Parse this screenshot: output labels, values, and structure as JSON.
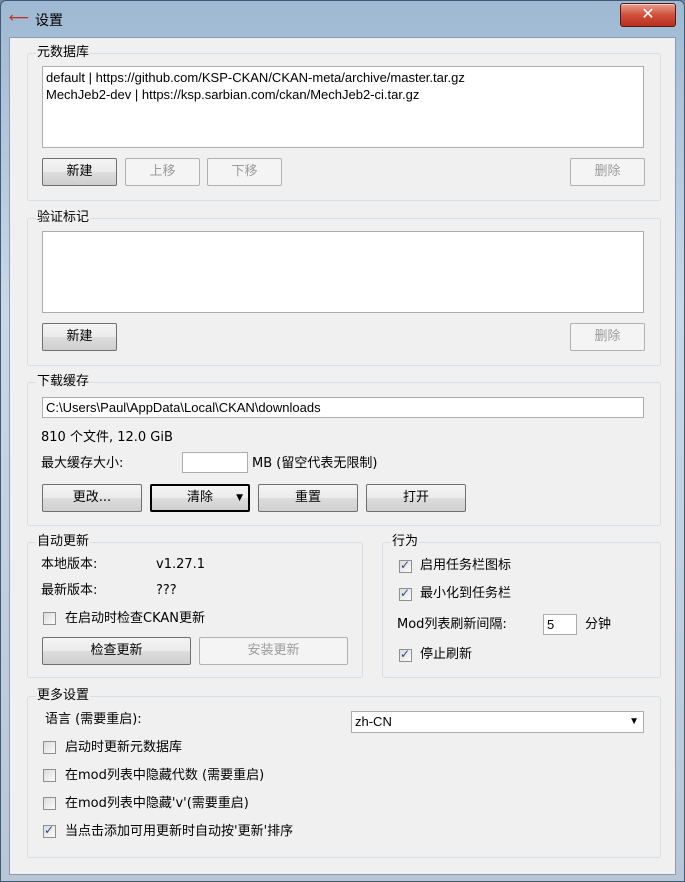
{
  "window": {
    "title": "设置",
    "close_label": "✕"
  },
  "metadata_repos": {
    "title": "元数据库",
    "items": [
      "default | https://github.com/KSP-CKAN/CKAN-meta/archive/master.tar.gz",
      "MechJeb2-dev | https://ksp.sarbian.com/ckan/MechJeb2-ci.tar.gz"
    ],
    "new_label": "新建",
    "up_label": "上移",
    "down_label": "下移",
    "delete_label": "删除"
  },
  "auth_tokens": {
    "title": "验证标记",
    "new_label": "新建",
    "delete_label": "删除"
  },
  "download_cache": {
    "title": "下载缓存",
    "path": "C:\\Users\\Paul\\AppData\\Local\\CKAN\\downloads",
    "summary": "810 个文件, 12.0 GiB",
    "max_size_label": "最大缓存大小:",
    "max_size_value": "",
    "max_size_unit": "MB (留空代表无限制)",
    "change_label": "更改...",
    "clear_label": "清除",
    "reset_label": "重置",
    "open_label": "打开"
  },
  "auto_update": {
    "title": "自动更新",
    "local_version_label": "本地版本:",
    "local_version": "v1.27.1",
    "latest_version_label": "最新版本:",
    "latest_version": "???",
    "check_on_launch_label": "在启动时检查CKAN更新",
    "check_on_launch": false,
    "check_label": "检查更新",
    "install_label": "安装更新"
  },
  "behavior": {
    "title": "行为",
    "tray_icon_label": "启用任务栏图标",
    "tray_icon": true,
    "minimize_label": "最小化到任务栏",
    "minimize": true,
    "refresh_label": "Mod列表刷新间隔:",
    "refresh_value": "5",
    "refresh_unit": "分钟",
    "pause_refresh_label": "停止刷新",
    "pause_refresh": true
  },
  "more_settings": {
    "title": "更多设置",
    "language_label": "语言 (需要重启):",
    "language_value": "zh-CN",
    "refresh_on_start_label": "启动时更新元数据库",
    "refresh_on_start": false,
    "hide_epochs_label": "在mod列表中隐藏代数 (需要重启)",
    "hide_epochs": false,
    "hide_v_label": "在mod列表中隐藏'v'(需要重启)",
    "hide_v": false,
    "auto_sort_label": "当点击添加可用更新时自动按'更新'排序",
    "auto_sort": true
  }
}
